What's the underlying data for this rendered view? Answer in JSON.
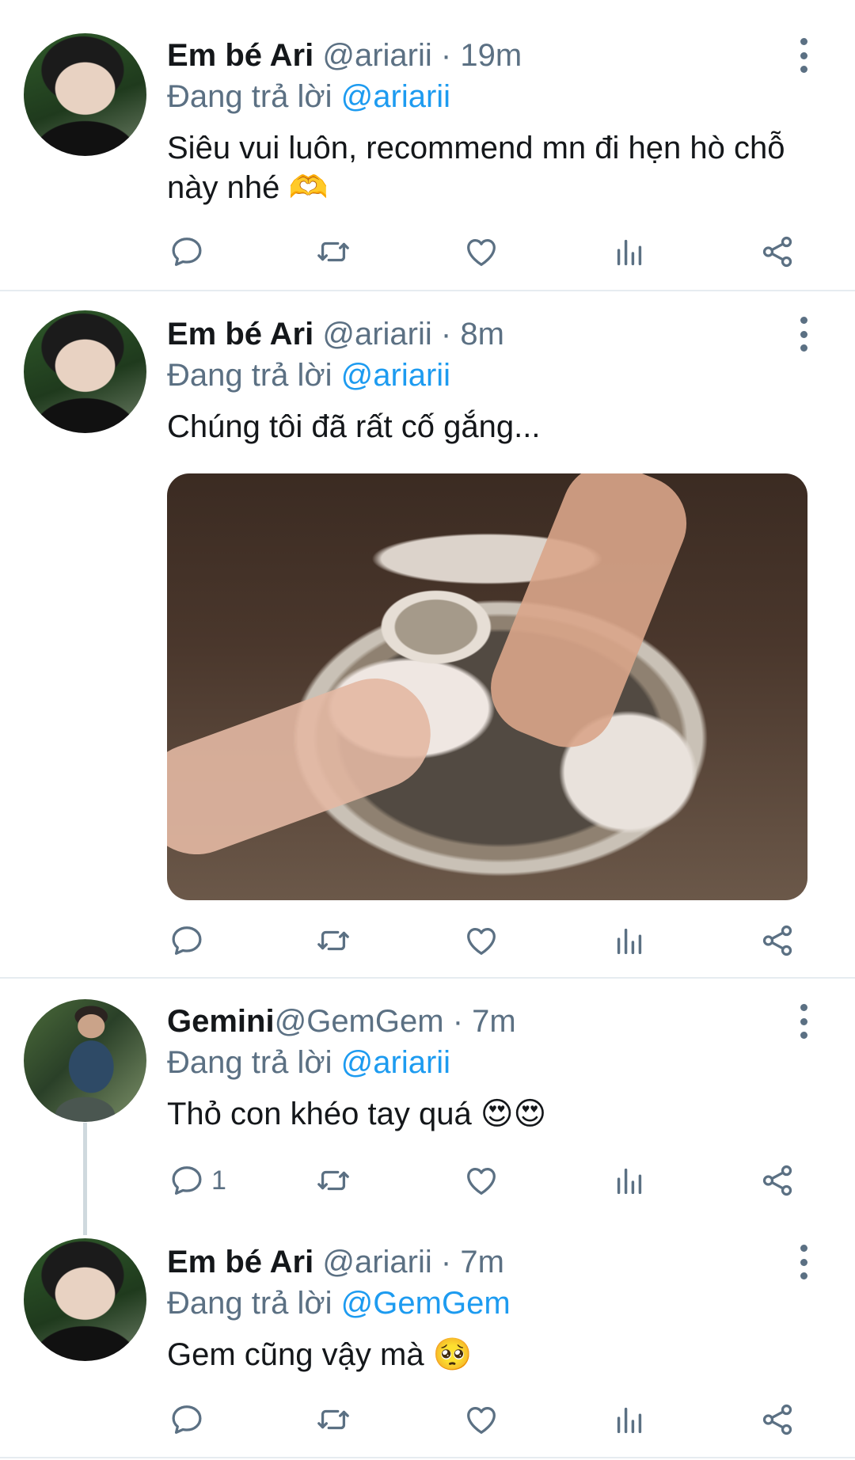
{
  "tweets": [
    {
      "name": "Em bé Ari",
      "handle": "@ariarii",
      "dot": "·",
      "time": "19m",
      "replying_prefix": "Đang trả lời",
      "replying_to": "@ariarii",
      "text": "Siêu vui luôn, recommend mn đi hẹn hò chỗ này nhé 🫶",
      "reply_count": ""
    },
    {
      "name": "Em bé Ari",
      "handle": "@ariarii",
      "dot": "·",
      "time": "8m",
      "replying_prefix": "Đang trả lời",
      "replying_to": "@ariarii",
      "text": "Chúng tôi đã rất cố gắng...",
      "reply_count": "",
      "media": "pottery-wheel-hands-photo"
    },
    {
      "name": "Gemini",
      "handle": "@GemGem",
      "dot": "·",
      "time": "7m",
      "replying_prefix": "Đang trả lời",
      "replying_to": "@ariarii",
      "text": "Thỏ con khéo tay quá 😍😍",
      "reply_count": "1"
    },
    {
      "name": "Em bé Ari",
      "handle": "@ariarii",
      "dot": "·",
      "time": "7m",
      "replying_prefix": "Đang trả lời",
      "replying_to": "@GemGem",
      "text": "Gem cũng vậy mà 🥺",
      "reply_count": ""
    }
  ],
  "icons": [
    "reply-icon",
    "retweet-icon",
    "like-icon",
    "analytics-icon",
    "share-icon",
    "more-icon"
  ],
  "colors": {
    "link": "#1d9bf0",
    "muted": "#5b7083",
    "text": "#14171a",
    "divider": "#e6ecf0"
  }
}
